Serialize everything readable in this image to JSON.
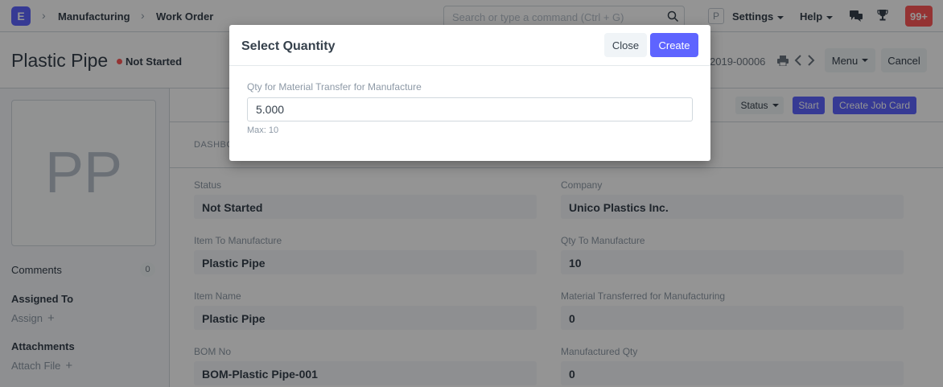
{
  "navbar": {
    "logo_letter": "E",
    "breadcrumbs": [
      "Manufacturing",
      "Work Order"
    ],
    "search_placeholder": "Search or type a command (Ctrl + G)",
    "user_initial": "P",
    "settings_label": "Settings",
    "help_label": "Help",
    "notification_count": "99+"
  },
  "page": {
    "title": "Plastic Pipe",
    "status": "Not Started",
    "status_color": "#ff5858",
    "doc_id_partial": "2019-00006",
    "menu_label": "Menu",
    "cancel_label": "Cancel"
  },
  "sidebar": {
    "image_initials": "PP",
    "comments_label": "Comments",
    "comments_count": "0",
    "assigned_to_label": "Assigned To",
    "assign_link": "Assign",
    "attachments_label": "Attachments",
    "attach_link": "Attach File"
  },
  "toolbar": {
    "status_label": "Status",
    "start_label": "Start",
    "create_job_card_label": "Create Job Card"
  },
  "dashboard_label_partial": "DASHBO",
  "fields": {
    "status_label": "Status",
    "status_value": "Not Started",
    "company_label": "Company",
    "company_value": "Unico Plastics Inc.",
    "item_to_manufacture_label": "Item To Manufacture",
    "item_to_manufacture_value": "Plastic Pipe",
    "qty_to_manufacture_label": "Qty To Manufacture",
    "qty_to_manufacture_value": "10",
    "item_name_label": "Item Name",
    "item_name_value": "Plastic Pipe",
    "material_transferred_label": "Material Transferred for Manufacturing",
    "material_transferred_value": "0",
    "bom_no_label": "BOM No",
    "bom_no_value": "BOM-Plastic Pipe-001",
    "manufactured_qty_label": "Manufactured Qty",
    "manufactured_qty_value": "0"
  },
  "modal": {
    "title": "Select Quantity",
    "close_label": "Close",
    "create_label": "Create",
    "field_label": "Qty for Material Transfer for Manufacture",
    "field_value": "5.000",
    "help_text": "Max: 10"
  },
  "colors": {
    "primary": "#5e64ff",
    "danger": "#ff5858"
  }
}
